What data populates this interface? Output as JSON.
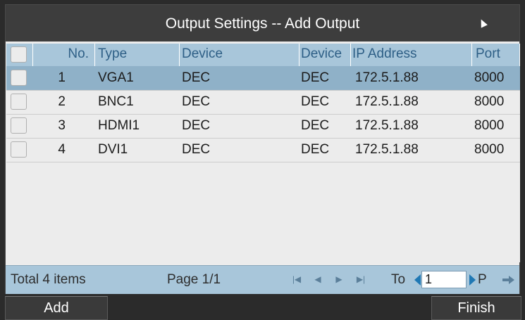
{
  "window": {
    "title": "Output Settings -- Add Output"
  },
  "table": {
    "headers": [
      "No.",
      "Type",
      "Device",
      "Device",
      "IP Address",
      "Port"
    ],
    "rows": [
      {
        "no": "1",
        "type": "VGA1",
        "device": "DEC",
        "device2": "DEC",
        "ip": "172.5.1.88",
        "port": "8000",
        "selected": true
      },
      {
        "no": "2",
        "type": "BNC1",
        "device": "DEC",
        "device2": "DEC",
        "ip": "172.5.1.88",
        "port": "8000",
        "selected": false
      },
      {
        "no": "3",
        "type": "HDMI1",
        "device": "DEC",
        "device2": "DEC",
        "ip": "172.5.1.88",
        "port": "8000",
        "selected": false
      },
      {
        "no": "4",
        "type": "DVI1",
        "device": "DEC",
        "device2": "DEC",
        "ip": "172.5.1.88",
        "port": "8000",
        "selected": false
      }
    ]
  },
  "footer": {
    "total": "Total 4 items",
    "page": "Page 1/1",
    "to_label": "To",
    "page_input": "1",
    "p_label": "P"
  },
  "buttons": {
    "add": "Add",
    "finish": "Finish"
  },
  "colors": {
    "header_bg": "#a8c6da",
    "selected_row": "#8fb1c8",
    "title_bg": "#3d3d3d",
    "accent": "#1f78b4"
  },
  "icons": [
    "first-page-icon",
    "prev-page-icon",
    "next-page-icon",
    "last-page-icon",
    "next-arrow-icon",
    "cursor-icon"
  ]
}
